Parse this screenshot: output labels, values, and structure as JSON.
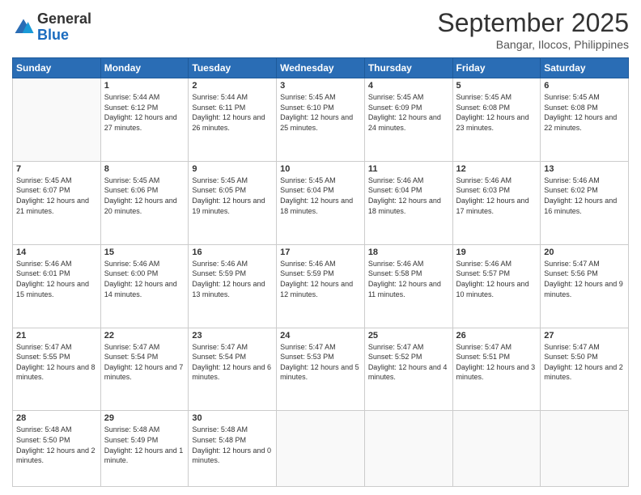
{
  "logo": {
    "general": "General",
    "blue": "Blue"
  },
  "header": {
    "month": "September 2025",
    "location": "Bangar, Ilocos, Philippines"
  },
  "days_of_week": [
    "Sunday",
    "Monday",
    "Tuesday",
    "Wednesday",
    "Thursday",
    "Friday",
    "Saturday"
  ],
  "weeks": [
    [
      {
        "day": "",
        "sunrise": "",
        "sunset": "",
        "daylight": ""
      },
      {
        "day": "1",
        "sunrise": "Sunrise: 5:44 AM",
        "sunset": "Sunset: 6:12 PM",
        "daylight": "Daylight: 12 hours and 27 minutes."
      },
      {
        "day": "2",
        "sunrise": "Sunrise: 5:44 AM",
        "sunset": "Sunset: 6:11 PM",
        "daylight": "Daylight: 12 hours and 26 minutes."
      },
      {
        "day": "3",
        "sunrise": "Sunrise: 5:45 AM",
        "sunset": "Sunset: 6:10 PM",
        "daylight": "Daylight: 12 hours and 25 minutes."
      },
      {
        "day": "4",
        "sunrise": "Sunrise: 5:45 AM",
        "sunset": "Sunset: 6:09 PM",
        "daylight": "Daylight: 12 hours and 24 minutes."
      },
      {
        "day": "5",
        "sunrise": "Sunrise: 5:45 AM",
        "sunset": "Sunset: 6:08 PM",
        "daylight": "Daylight: 12 hours and 23 minutes."
      },
      {
        "day": "6",
        "sunrise": "Sunrise: 5:45 AM",
        "sunset": "Sunset: 6:08 PM",
        "daylight": "Daylight: 12 hours and 22 minutes."
      }
    ],
    [
      {
        "day": "7",
        "sunrise": "Sunrise: 5:45 AM",
        "sunset": "Sunset: 6:07 PM",
        "daylight": "Daylight: 12 hours and 21 minutes."
      },
      {
        "day": "8",
        "sunrise": "Sunrise: 5:45 AM",
        "sunset": "Sunset: 6:06 PM",
        "daylight": "Daylight: 12 hours and 20 minutes."
      },
      {
        "day": "9",
        "sunrise": "Sunrise: 5:45 AM",
        "sunset": "Sunset: 6:05 PM",
        "daylight": "Daylight: 12 hours and 19 minutes."
      },
      {
        "day": "10",
        "sunrise": "Sunrise: 5:45 AM",
        "sunset": "Sunset: 6:04 PM",
        "daylight": "Daylight: 12 hours and 18 minutes."
      },
      {
        "day": "11",
        "sunrise": "Sunrise: 5:46 AM",
        "sunset": "Sunset: 6:04 PM",
        "daylight": "Daylight: 12 hours and 18 minutes."
      },
      {
        "day": "12",
        "sunrise": "Sunrise: 5:46 AM",
        "sunset": "Sunset: 6:03 PM",
        "daylight": "Daylight: 12 hours and 17 minutes."
      },
      {
        "day": "13",
        "sunrise": "Sunrise: 5:46 AM",
        "sunset": "Sunset: 6:02 PM",
        "daylight": "Daylight: 12 hours and 16 minutes."
      }
    ],
    [
      {
        "day": "14",
        "sunrise": "Sunrise: 5:46 AM",
        "sunset": "Sunset: 6:01 PM",
        "daylight": "Daylight: 12 hours and 15 minutes."
      },
      {
        "day": "15",
        "sunrise": "Sunrise: 5:46 AM",
        "sunset": "Sunset: 6:00 PM",
        "daylight": "Daylight: 12 hours and 14 minutes."
      },
      {
        "day": "16",
        "sunrise": "Sunrise: 5:46 AM",
        "sunset": "Sunset: 5:59 PM",
        "daylight": "Daylight: 12 hours and 13 minutes."
      },
      {
        "day": "17",
        "sunrise": "Sunrise: 5:46 AM",
        "sunset": "Sunset: 5:59 PM",
        "daylight": "Daylight: 12 hours and 12 minutes."
      },
      {
        "day": "18",
        "sunrise": "Sunrise: 5:46 AM",
        "sunset": "Sunset: 5:58 PM",
        "daylight": "Daylight: 12 hours and 11 minutes."
      },
      {
        "day": "19",
        "sunrise": "Sunrise: 5:46 AM",
        "sunset": "Sunset: 5:57 PM",
        "daylight": "Daylight: 12 hours and 10 minutes."
      },
      {
        "day": "20",
        "sunrise": "Sunrise: 5:47 AM",
        "sunset": "Sunset: 5:56 PM",
        "daylight": "Daylight: 12 hours and 9 minutes."
      }
    ],
    [
      {
        "day": "21",
        "sunrise": "Sunrise: 5:47 AM",
        "sunset": "Sunset: 5:55 PM",
        "daylight": "Daylight: 12 hours and 8 minutes."
      },
      {
        "day": "22",
        "sunrise": "Sunrise: 5:47 AM",
        "sunset": "Sunset: 5:54 PM",
        "daylight": "Daylight: 12 hours and 7 minutes."
      },
      {
        "day": "23",
        "sunrise": "Sunrise: 5:47 AM",
        "sunset": "Sunset: 5:54 PM",
        "daylight": "Daylight: 12 hours and 6 minutes."
      },
      {
        "day": "24",
        "sunrise": "Sunrise: 5:47 AM",
        "sunset": "Sunset: 5:53 PM",
        "daylight": "Daylight: 12 hours and 5 minutes."
      },
      {
        "day": "25",
        "sunrise": "Sunrise: 5:47 AM",
        "sunset": "Sunset: 5:52 PM",
        "daylight": "Daylight: 12 hours and 4 minutes."
      },
      {
        "day": "26",
        "sunrise": "Sunrise: 5:47 AM",
        "sunset": "Sunset: 5:51 PM",
        "daylight": "Daylight: 12 hours and 3 minutes."
      },
      {
        "day": "27",
        "sunrise": "Sunrise: 5:47 AM",
        "sunset": "Sunset: 5:50 PM",
        "daylight": "Daylight: 12 hours and 2 minutes."
      }
    ],
    [
      {
        "day": "28",
        "sunrise": "Sunrise: 5:48 AM",
        "sunset": "Sunset: 5:50 PM",
        "daylight": "Daylight: 12 hours and 2 minutes."
      },
      {
        "day": "29",
        "sunrise": "Sunrise: 5:48 AM",
        "sunset": "Sunset: 5:49 PM",
        "daylight": "Daylight: 12 hours and 1 minute."
      },
      {
        "day": "30",
        "sunrise": "Sunrise: 5:48 AM",
        "sunset": "Sunset: 5:48 PM",
        "daylight": "Daylight: 12 hours and 0 minutes."
      },
      {
        "day": "",
        "sunrise": "",
        "sunset": "",
        "daylight": ""
      },
      {
        "day": "",
        "sunrise": "",
        "sunset": "",
        "daylight": ""
      },
      {
        "day": "",
        "sunrise": "",
        "sunset": "",
        "daylight": ""
      },
      {
        "day": "",
        "sunrise": "",
        "sunset": "",
        "daylight": ""
      }
    ]
  ]
}
